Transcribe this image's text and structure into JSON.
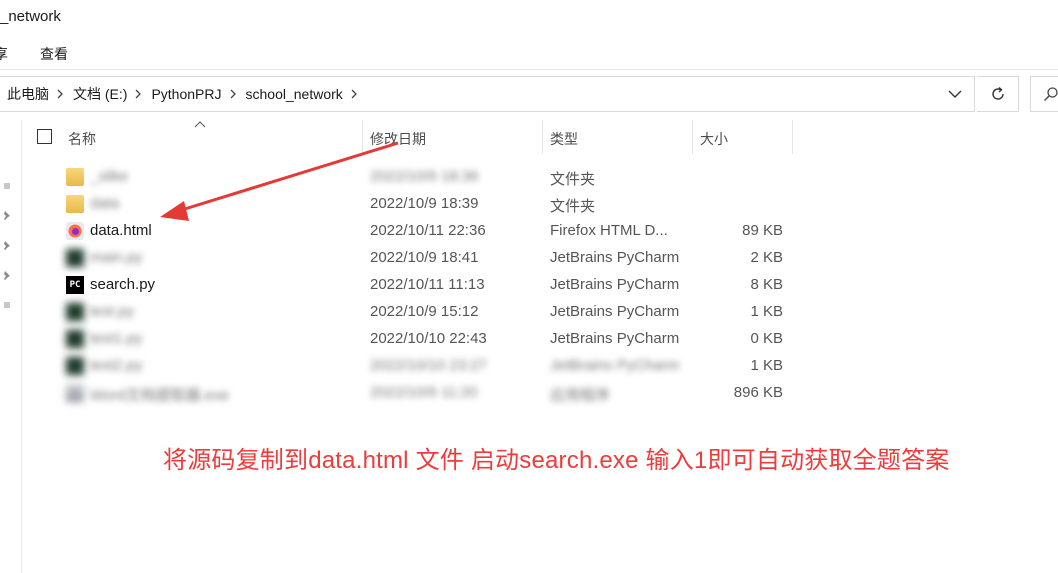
{
  "window": {
    "title": "_network"
  },
  "ribbon": {
    "tab_share_partial": "享",
    "tab_view": "查看"
  },
  "address": {
    "crumbs": [
      "此电脑",
      "文档 (E:)",
      "PythonPRJ",
      "school_network"
    ]
  },
  "columns": {
    "name": "名称",
    "date": "修改日期",
    "type": "类型",
    "size": "大小"
  },
  "files": [
    {
      "name": "_slike",
      "date": "2022/10/9 18:36",
      "type": "文件夹",
      "size": "",
      "icon": "folder-icon",
      "name_blurred": true,
      "date_blurred": true
    },
    {
      "name": "data",
      "date": "2022/10/9 18:39",
      "type": "文件夹",
      "size": "",
      "icon": "folder-icon",
      "name_blurred": true
    },
    {
      "name": "data.html",
      "date": "2022/10/11 22:36",
      "type": "Firefox HTML D...",
      "size": "89 KB",
      "icon": "firefox-html-icon"
    },
    {
      "name": "main.py",
      "date": "2022/10/9 18:41",
      "type": "JetBrains PyCharm",
      "size": "2 KB",
      "icon": "pycharm-icon",
      "name_blurred": true
    },
    {
      "name": "search.py",
      "date": "2022/10/11 11:13",
      "type": "JetBrains PyCharm",
      "size": "8 KB",
      "icon": "pycharm-icon"
    },
    {
      "name": "test.py",
      "date": "2022/10/9 15:12",
      "type": "JetBrains PyCharm",
      "size": "1 KB",
      "icon": "pycharm-icon",
      "name_blurred": true
    },
    {
      "name": "test1.py",
      "date": "2022/10/10 22:43",
      "type": "JetBrains PyCharm",
      "size": "0 KB",
      "icon": "pycharm-icon",
      "name_blurred": true
    },
    {
      "name": "test2.py",
      "date": "2022/10/10 23:27",
      "type": "JetBrains PyCharm",
      "size": "1 KB",
      "icon": "pycharm-icon",
      "name_blurred": true,
      "date_blurred": true,
      "type_blurred": true
    },
    {
      "name": "Word文档提取器.exe",
      "date": "2022/10/9 11:20",
      "type": "应用程序",
      "size": "896 KB",
      "icon": "exe-icon",
      "name_blurred": true,
      "date_blurred": true,
      "type_blurred": true
    }
  ],
  "annotation": {
    "text": "将源码复制到data.html 文件  启动search.exe 输入1即可自动获取全题答案",
    "color": "#ee3b3b"
  }
}
